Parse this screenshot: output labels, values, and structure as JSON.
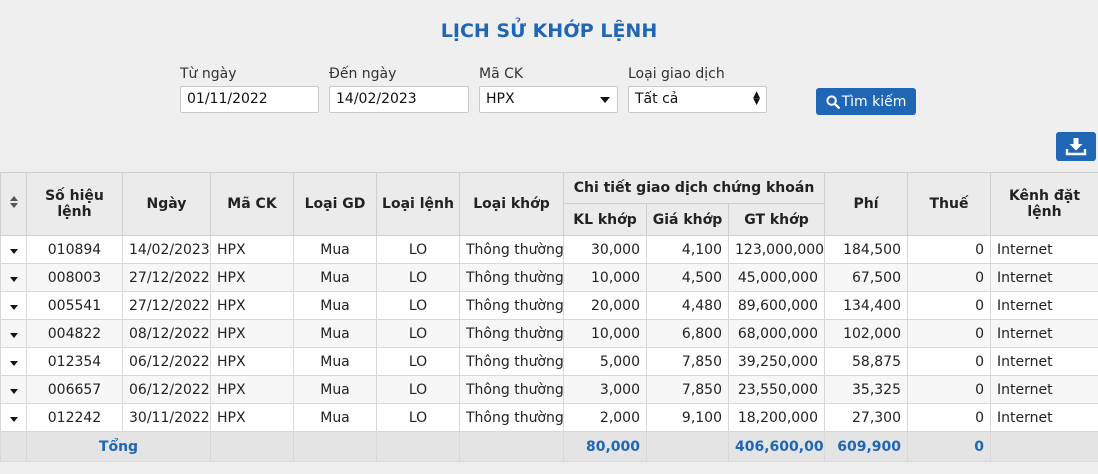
{
  "page": {
    "title": "LỊCH SỬ KHỚP LỆNH"
  },
  "filters": {
    "from_date": {
      "label": "Từ ngày",
      "value": "01/11/2022"
    },
    "to_date": {
      "label": "Đến ngày",
      "value": "14/02/2023"
    },
    "stock_code": {
      "label": "Mã CK",
      "value": "HPX"
    },
    "trade_type": {
      "label": "Loại giao dịch",
      "value": "Tất cả"
    },
    "search_label": "Tìm kiếm"
  },
  "colors": {
    "accent": "#1f66b5",
    "header_bg": "#ebebeb",
    "footer_bg": "#e4e4e4"
  },
  "table": {
    "headers": {
      "order_no": "Số hiệu lệnh",
      "date": "Ngày",
      "code": "Mã CK",
      "trade_type": "Loại GD",
      "order_type": "Loại lệnh",
      "match_type": "Loại khớp",
      "detail_group": "Chi tiết giao dịch chứng khoán",
      "qty": "KL khớp",
      "price": "Giá khớp",
      "value": "GT khớp",
      "fee": "Phí",
      "tax": "Thuế",
      "channel": "Kênh đặt lệnh"
    },
    "rows": [
      {
        "order_no": "010894",
        "date": "14/02/2023",
        "code": "HPX",
        "trade_type": "Mua",
        "order_type": "LO",
        "match_type": "Thông thường",
        "qty": "30,000",
        "price": "4,100",
        "value": "123,000,000",
        "fee": "184,500",
        "tax": "0",
        "channel": "Internet"
      },
      {
        "order_no": "008003",
        "date": "27/12/2022",
        "code": "HPX",
        "trade_type": "Mua",
        "order_type": "LO",
        "match_type": "Thông thường",
        "qty": "10,000",
        "price": "4,500",
        "value": "45,000,000",
        "fee": "67,500",
        "tax": "0",
        "channel": "Internet"
      },
      {
        "order_no": "005541",
        "date": "27/12/2022",
        "code": "HPX",
        "trade_type": "Mua",
        "order_type": "LO",
        "match_type": "Thông thường",
        "qty": "20,000",
        "price": "4,480",
        "value": "89,600,000",
        "fee": "134,400",
        "tax": "0",
        "channel": "Internet"
      },
      {
        "order_no": "004822",
        "date": "08/12/2022",
        "code": "HPX",
        "trade_type": "Mua",
        "order_type": "LO",
        "match_type": "Thông thường",
        "qty": "10,000",
        "price": "6,800",
        "value": "68,000,000",
        "fee": "102,000",
        "tax": "0",
        "channel": "Internet"
      },
      {
        "order_no": "012354",
        "date": "06/12/2022",
        "code": "HPX",
        "trade_type": "Mua",
        "order_type": "LO",
        "match_type": "Thông thường",
        "qty": "5,000",
        "price": "7,850",
        "value": "39,250,000",
        "fee": "58,875",
        "tax": "0",
        "channel": "Internet"
      },
      {
        "order_no": "006657",
        "date": "06/12/2022",
        "code": "HPX",
        "trade_type": "Mua",
        "order_type": "LO",
        "match_type": "Thông thường",
        "qty": "3,000",
        "price": "7,850",
        "value": "23,550,000",
        "fee": "35,325",
        "tax": "0",
        "channel": "Internet"
      },
      {
        "order_no": "012242",
        "date": "30/11/2022",
        "code": "HPX",
        "trade_type": "Mua",
        "order_type": "LO",
        "match_type": "Thông thường",
        "qty": "2,000",
        "price": "9,100",
        "value": "18,200,000",
        "fee": "27,300",
        "tax": "0",
        "channel": "Internet"
      }
    ],
    "totals": {
      "label": "Tổng",
      "qty": "80,000",
      "value": "406,600,000",
      "fee": "609,900",
      "tax": "0"
    }
  }
}
